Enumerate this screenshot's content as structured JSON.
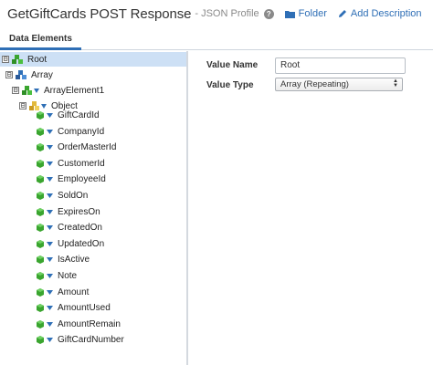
{
  "header": {
    "title": "GetGiftCards POST Response",
    "subtitle": "- JSON Profile",
    "folder_label": "Folder",
    "add_description_label": "Add Description"
  },
  "tabs": [
    {
      "label": "Data Elements",
      "active": true
    }
  ],
  "tree": {
    "selected": "Root",
    "nodes": [
      {
        "label": "Root",
        "toggle": "⊟",
        "icon": "root-group-icon"
      },
      {
        "label": "Array",
        "toggle": "⊟",
        "icon": "array-group-icon"
      },
      {
        "label": "ArrayElement1",
        "toggle": "⊟",
        "icon": "array-element-icon"
      },
      {
        "label": "Object",
        "toggle": "⊟",
        "icon": "object-icon"
      },
      {
        "label": "GiftCardId",
        "icon": "field-icon"
      },
      {
        "label": "CompanyId",
        "icon": "field-icon"
      },
      {
        "label": "OrderMasterId",
        "icon": "field-icon"
      },
      {
        "label": "CustomerId",
        "icon": "field-icon"
      },
      {
        "label": "EmployeeId",
        "icon": "field-icon"
      },
      {
        "label": "SoldOn",
        "icon": "field-icon"
      },
      {
        "label": "ExpiresOn",
        "icon": "field-icon"
      },
      {
        "label": "CreatedOn",
        "icon": "field-icon"
      },
      {
        "label": "UpdatedOn",
        "icon": "field-icon"
      },
      {
        "label": "IsActive",
        "icon": "field-icon"
      },
      {
        "label": "Note",
        "icon": "field-icon"
      },
      {
        "label": "Amount",
        "icon": "field-icon"
      },
      {
        "label": "AmountUsed",
        "icon": "field-icon"
      },
      {
        "label": "AmountRemain",
        "icon": "field-icon"
      },
      {
        "label": "GiftCardNumber",
        "icon": "field-icon"
      }
    ]
  },
  "detail": {
    "value_name_label": "Value Name",
    "value_name": "Root",
    "value_type_label": "Value Type",
    "value_type": "Array (Repeating)"
  },
  "colors": {
    "accent": "#2f6fb6",
    "selected_row": "#cde0f5",
    "green_cube": "#3aa52f",
    "blue_triangle": "#2f6fb6",
    "yellow_cube": "#e2b93b"
  }
}
